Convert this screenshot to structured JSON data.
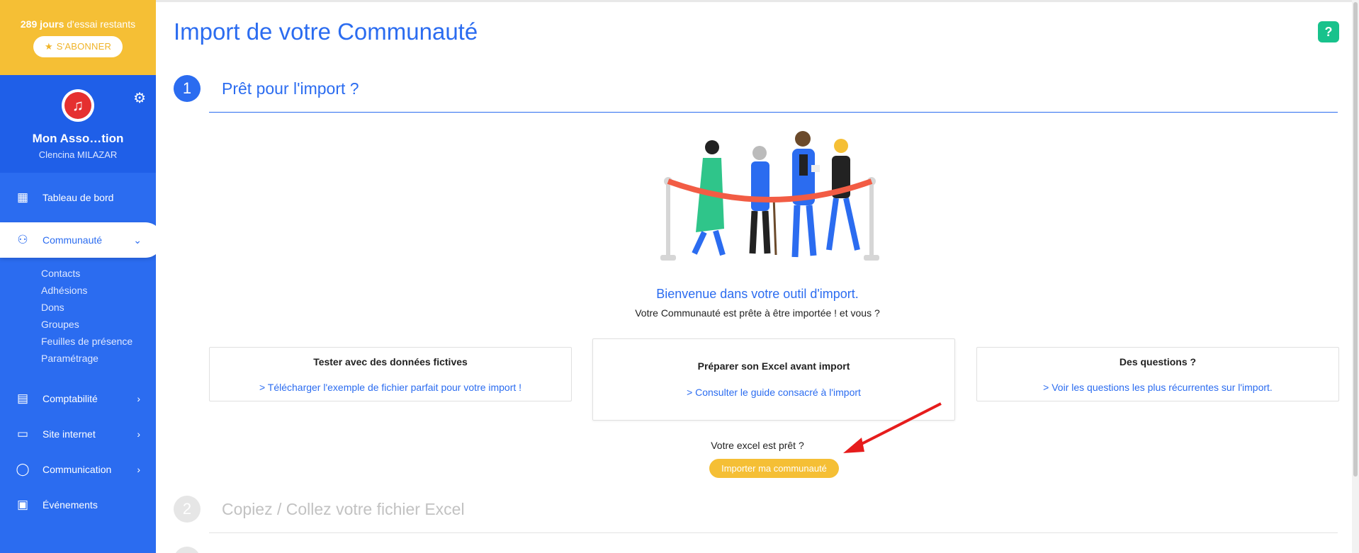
{
  "trial": {
    "days": "289 jours",
    "text": " d'essai restants",
    "subscribe_label": "S'ABONNER"
  },
  "profile": {
    "org_name": "Mon Asso…tion",
    "user_name": "Clencina MILAZAR"
  },
  "nav": {
    "dashboard": "Tableau de bord",
    "community": "Communauté",
    "community_sub": [
      "Contacts",
      "Adhésions",
      "Dons",
      "Groupes",
      "Feuilles de présence",
      "Paramétrage"
    ],
    "accounting": "Comptabilité",
    "website": "Site internet",
    "communication": "Communication",
    "events": "Événements"
  },
  "page": {
    "title": "Import de votre Communauté",
    "help": "?"
  },
  "steps": [
    {
      "num": "1",
      "title": "Prêt pour l'import ?"
    },
    {
      "num": "2",
      "title": "Copiez / Collez votre fichier Excel"
    }
  ],
  "welcome": {
    "title": "Bienvenue dans votre outil d'import.",
    "subtitle": "Votre Communauté est prête à être importée ! et vous ?"
  },
  "cards": [
    {
      "title": "Tester avec des données fictives",
      "link": "> Télécharger l'exemple de fichier parfait pour votre import !"
    },
    {
      "title": "Préparer son Excel avant import",
      "link": "> Consulter le guide consacré à l'import"
    },
    {
      "title": "Des questions ?",
      "link": "> Voir les questions les plus récurrentes sur l'import."
    }
  ],
  "ready": {
    "question": "Votre excel est prêt ?",
    "button": "Importer ma communauté"
  },
  "colors": {
    "primary": "#2b6cf0",
    "accent": "#f5bf35",
    "help": "#18c28c",
    "arrow": "#e61c1c"
  }
}
